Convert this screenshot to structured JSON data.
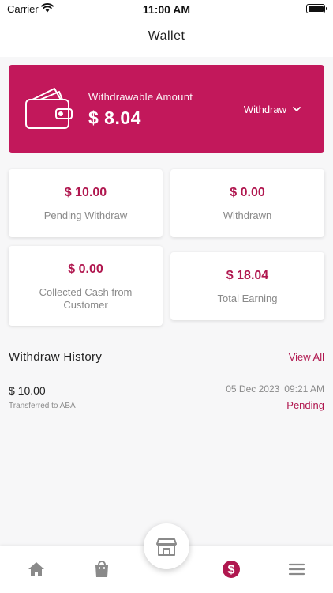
{
  "status_bar": {
    "carrier": "Carrier",
    "time": "11:00 AM"
  },
  "header": {
    "title": "Wallet"
  },
  "hero": {
    "label": "Withdrawable Amount",
    "amount": "$ 8.04",
    "withdraw_label": "Withdraw",
    "icon": "wallet-icon"
  },
  "stats": [
    {
      "value": "$ 10.00",
      "label": "Pending Withdraw"
    },
    {
      "value": "$ 0.00",
      "label": "Withdrawn"
    },
    {
      "value": "$ 0.00",
      "label": "Collected Cash from Customer"
    },
    {
      "value": "$ 18.04",
      "label": "Total Earning"
    }
  ],
  "history": {
    "title": "Withdraw History",
    "view_all": "View All",
    "items": [
      {
        "amount": "$ 10.00",
        "description": "Transferred to ABA",
        "date": "05 Dec 2023",
        "time": "09:21 AM",
        "status": "Pending"
      }
    ]
  },
  "bottom_nav": {
    "items": [
      "home-icon",
      "shopping-bag-icon",
      "store-icon",
      "dollar-icon",
      "menu-icon"
    ],
    "active": "dollar-icon"
  },
  "colors": {
    "accent": "#c2185b",
    "accent_text": "#b0174f",
    "muted": "#8a8a8a",
    "nav_inactive": "#8a8a8a"
  }
}
